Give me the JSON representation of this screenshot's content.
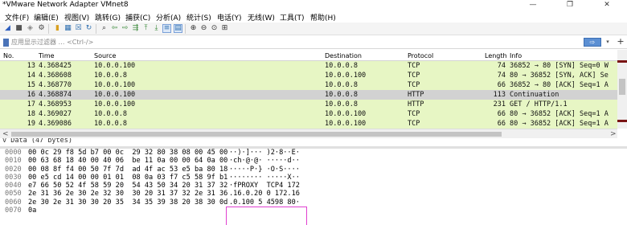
{
  "window": {
    "title": "*VMware Network Adapter VMnet8",
    "minimize": "—",
    "restore": "❐",
    "close": "✕"
  },
  "menu": [
    "文件(F)",
    "编辑(E)",
    "视图(V)",
    "跳转(G)",
    "捕获(C)",
    "分析(A)",
    "统计(S)",
    "电话(Y)",
    "无线(W)",
    "工具(T)",
    "帮助(H)"
  ],
  "toolbar_icons": [
    "shark-fin-icon",
    "stop-icon",
    "restart-icon",
    "options-gear-icon",
    "open-file-icon",
    "save-file-icon",
    "close-file-icon",
    "reload-icon",
    "find-icon",
    "go-back-icon",
    "go-forward-icon",
    "go-to-packet-icon",
    "first-packet-icon",
    "last-packet-icon",
    "autoscroll-icon",
    "colorize-icon",
    "zoom-in-icon",
    "zoom-out-icon",
    "normal-size-icon",
    "resize-columns-icon"
  ],
  "filter": {
    "placeholder": "应用显示过滤器 … <Ctrl-/>",
    "apply_label": "⇨",
    "dropdown_label": "▾",
    "add_label": "+"
  },
  "columns": {
    "no": "No.",
    "time": "Time",
    "source": "Source",
    "destination": "Destination",
    "protocol": "Protocol",
    "length": "Length",
    "info": "Info"
  },
  "packets": [
    {
      "no": "13",
      "time": "4.368425",
      "src": "10.0.0.100",
      "dst": "10.0.0.8",
      "proto": "TCP",
      "len": "74",
      "info": "36852 → 80 [SYN] Seq=0 W"
    },
    {
      "no": "14",
      "time": "4.368608",
      "src": "10.0.0.8",
      "dst": "10.0.0.100",
      "proto": "TCP",
      "len": "74",
      "info": "80 → 36852 [SYN, ACK] Se"
    },
    {
      "no": "15",
      "time": "4.368770",
      "src": "10.0.0.100",
      "dst": "10.0.0.8",
      "proto": "TCP",
      "len": "66",
      "info": "36852 → 80 [ACK] Seq=1 A"
    },
    {
      "no": "16",
      "time": "4.368874",
      "src": "10.0.0.100",
      "dst": "10.0.0.8",
      "proto": "HTTP",
      "len": "113",
      "info": "Continuation"
    },
    {
      "no": "17",
      "time": "4.368953",
      "src": "10.0.0.100",
      "dst": "10.0.0.8",
      "proto": "HTTP",
      "len": "231",
      "info": "GET / HTTP/1.1"
    },
    {
      "no": "18",
      "time": "4.369027",
      "src": "10.0.0.8",
      "dst": "10.0.0.100",
      "proto": "TCP",
      "len": "66",
      "info": "80 → 36852 [ACK] Seq=1 A"
    },
    {
      "no": "19",
      "time": "4.369086",
      "src": "10.0.0.8",
      "dst": "10.0.0.100",
      "proto": "TCP",
      "len": "66",
      "info": "80 → 36852 [ACK] Seq=1 A"
    }
  ],
  "selected_packet_no": "16",
  "scroll": {
    "left_arrow": "<",
    "right_arrow": ">"
  },
  "detail_text": "v Data (47 bytes)",
  "hex_dump": [
    {
      "off": "0000",
      "bytes": "00 0c 29 f8 5d b7 00 0c  29 32 80 38 08 00 45 00",
      "ascii": "··)·]··· )2·8··E·"
    },
    {
      "off": "0010",
      "bytes": "00 63 68 18 40 00 40 06  be 11 0a 00 00 64 0a 00",
      "ascii": "·ch·@·@· ·····d··"
    },
    {
      "off": "0020",
      "bytes": "00 08 8f f4 00 50 7f 7d  ad 4f ac 53 e5 ba 80 18",
      "ascii": "·····P·} ·O·S····"
    },
    {
      "off": "0030",
      "bytes": "00 e5 cd 14 00 00 01 01  08 0a 03 f7 c5 58 9f b1",
      "ascii": "········ ·····X··"
    },
    {
      "off": "0040",
      "bytes": "e7 66 50 52 4f 58 59 20  54 43 50 34 20 31 37 32",
      "ascii": "·fPROXY  TCP4 172"
    },
    {
      "off": "0050",
      "bytes": "2e 31 36 2e 30 2e 32 30  30 20 31 37 32 2e 31 36",
      "ascii": ".16.0.20 0 172.16"
    },
    {
      "off": "0060",
      "bytes": "2e 30 2e 31 30 30 20 35  34 35 39 38 20 38 30 0d",
      "ascii": ".0.100 5 4598 80·"
    },
    {
      "off": "0070",
      "bytes": "0a",
      "ascii": ""
    }
  ],
  "colors": {
    "tcp_row": "#e7f6c4",
    "selected_row": "#d2d2d2",
    "highlight_box": "#e040d0",
    "scroll_mark": "#7a1414"
  }
}
